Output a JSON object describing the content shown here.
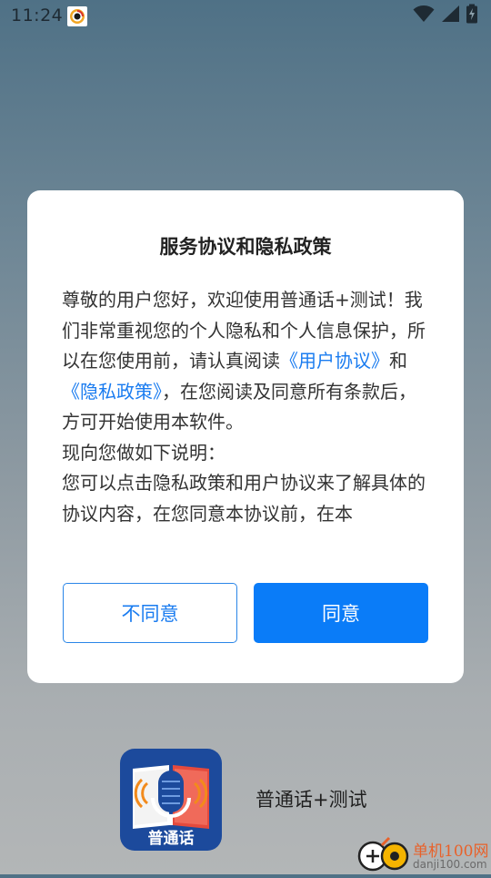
{
  "status_bar": {
    "time": "11:24",
    "notification_icon": "app-notification-icon",
    "icons": [
      "wifi-icon",
      "cellular-signal-icon",
      "battery-icon"
    ]
  },
  "dialog": {
    "title": "服务协议和隐私政策",
    "body_intro": "尊敬的用户您好，欢迎使用普通话+测试！我们非常重视您的个人隐私和个人信息保护，所以在您使用前，请认真阅读",
    "user_agreement_link": "《用户协议》",
    "and": "和",
    "privacy_policy_link": "《隐私政策》",
    "body_after_links": "，在您阅读及同意所有条款后，方可开始使用本软件。",
    "body_line2": "现向您做如下说明：",
    "body_line3": "您可以点击隐私政策和用户协议来了解具体的协议内容，在您同意本协议前，在本",
    "decline_label": "不同意",
    "agree_label": "同意"
  },
  "splash": {
    "app_logo_text": "普通话",
    "app_name": "普通话+测试"
  },
  "watermark": {
    "title": "单机100网",
    "url": "danji100.com"
  },
  "colors": {
    "accent": "#0a7cf8",
    "link": "#1a7cf0",
    "watermark": "#e8612a"
  }
}
